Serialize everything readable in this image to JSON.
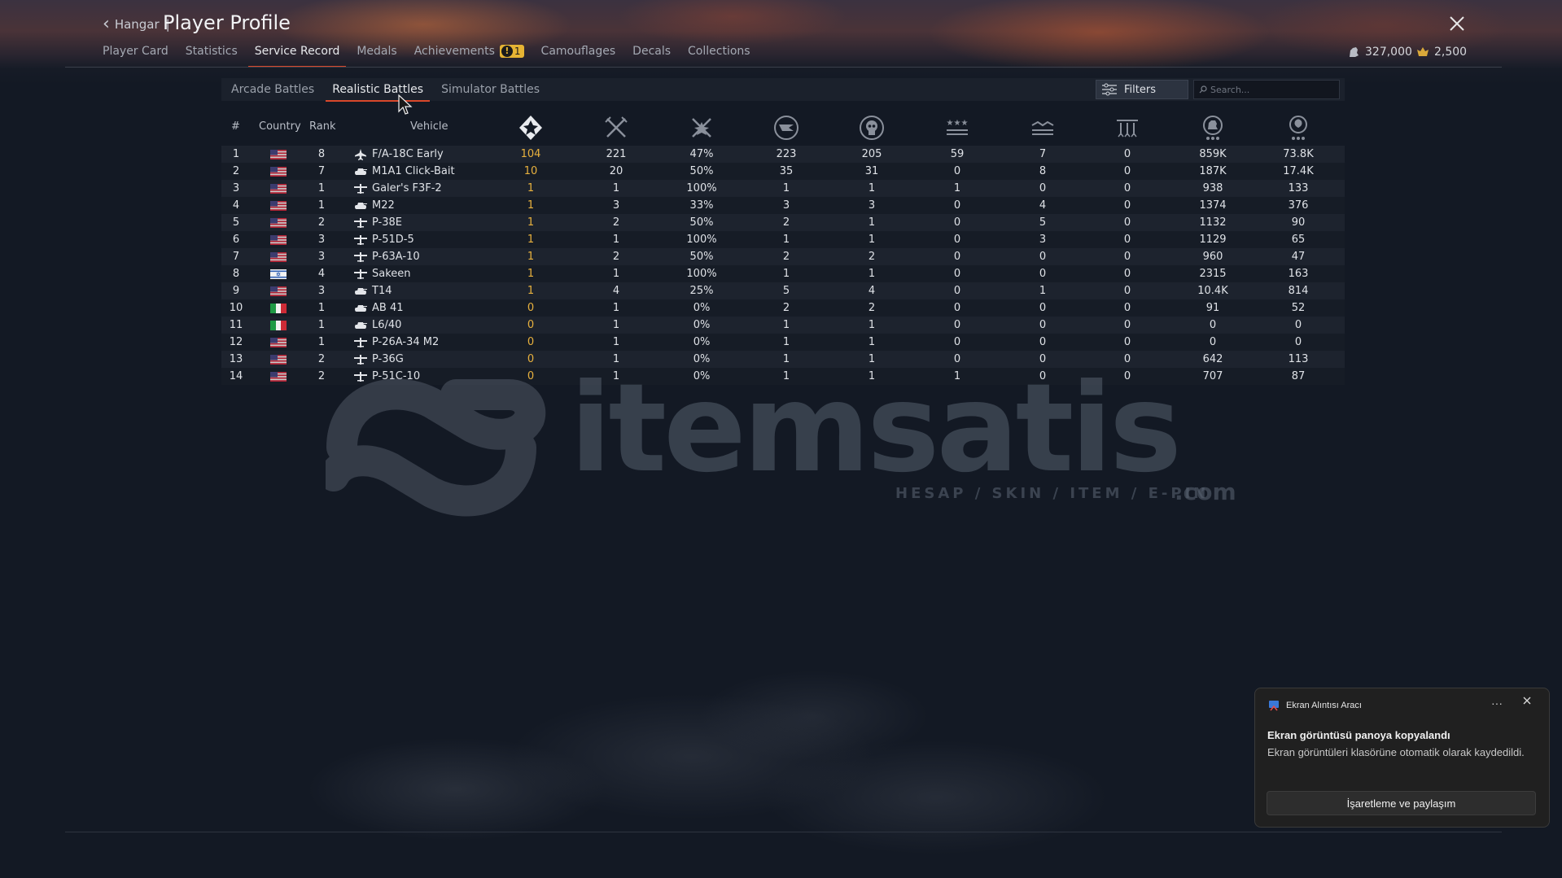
{
  "header": {
    "back_label": "Hangar",
    "separator": "|",
    "title": "Player Profile",
    "currencies": [
      {
        "icon": "silver-lions-icon",
        "value": "327,000"
      },
      {
        "icon": "golden-eagles-icon",
        "value": "2,500"
      }
    ]
  },
  "nav": {
    "tabs": [
      "Player Card",
      "Statistics",
      "Service Record",
      "Medals",
      "Achievements",
      "Camouflages",
      "Decals",
      "Collections"
    ],
    "active": "Service Record",
    "achievements_badge": "1"
  },
  "subtabs": {
    "items": [
      "Arcade Battles",
      "Realistic Battles",
      "Simulator Battles"
    ],
    "active": "Realistic Battles",
    "filters_label": "Filters",
    "search_placeholder": "Search..."
  },
  "table": {
    "headers": {
      "num": "#",
      "country": "Country",
      "rank": "Rank",
      "vehicle": "Vehicle"
    },
    "icon_columns": [
      "victories-icon",
      "battles-icon",
      "win-rate-icon",
      "respawns-icon",
      "deaths-icon",
      "air-kills-icon",
      "ground-kills-icon",
      "naval-kills-icon",
      "lions-earned-icon",
      "research-points-icon"
    ],
    "rows": [
      {
        "n": "1",
        "flag": "us",
        "rank": "8",
        "vtype": "jet",
        "vehicle": "F/A-18C Early",
        "v": [
          "104",
          "221",
          "47%",
          "223",
          "205",
          "59",
          "7",
          "0",
          "859K",
          "73.8K"
        ]
      },
      {
        "n": "2",
        "flag": "us",
        "rank": "7",
        "vtype": "tank",
        "vehicle": "M1A1 Click-Bait",
        "v": [
          "10",
          "20",
          "50%",
          "35",
          "31",
          "0",
          "8",
          "0",
          "187K",
          "17.4K"
        ]
      },
      {
        "n": "3",
        "flag": "us",
        "rank": "1",
        "vtype": "plane",
        "vehicle": "Galer's F3F-2",
        "v": [
          "1",
          "1",
          "100%",
          "1",
          "1",
          "1",
          "0",
          "0",
          "938",
          "133"
        ]
      },
      {
        "n": "4",
        "flag": "us",
        "rank": "1",
        "vtype": "tank",
        "vehicle": "M22",
        "v": [
          "1",
          "3",
          "33%",
          "3",
          "3",
          "0",
          "4",
          "0",
          "1374",
          "376"
        ]
      },
      {
        "n": "5",
        "flag": "us",
        "rank": "2",
        "vtype": "plane",
        "vehicle": "P-38E",
        "v": [
          "1",
          "2",
          "50%",
          "2",
          "1",
          "0",
          "5",
          "0",
          "1132",
          "90"
        ]
      },
      {
        "n": "6",
        "flag": "us",
        "rank": "3",
        "vtype": "plane",
        "vehicle": "P-51D-5",
        "v": [
          "1",
          "1",
          "100%",
          "1",
          "1",
          "0",
          "3",
          "0",
          "1129",
          "65"
        ]
      },
      {
        "n": "7",
        "flag": "us",
        "rank": "3",
        "vtype": "plane",
        "vehicle": "P-63A-10",
        "v": [
          "1",
          "2",
          "50%",
          "2",
          "2",
          "0",
          "0",
          "0",
          "960",
          "47"
        ]
      },
      {
        "n": "8",
        "flag": "il",
        "rank": "4",
        "vtype": "plane",
        "vehicle": "Sakeen",
        "v": [
          "1",
          "1",
          "100%",
          "1",
          "1",
          "0",
          "0",
          "0",
          "2315",
          "163"
        ]
      },
      {
        "n": "9",
        "flag": "us",
        "rank": "3",
        "vtype": "tank",
        "vehicle": "T14",
        "v": [
          "1",
          "4",
          "25%",
          "5",
          "4",
          "0",
          "1",
          "0",
          "10.4K",
          "814"
        ]
      },
      {
        "n": "10",
        "flag": "it",
        "rank": "1",
        "vtype": "tank",
        "vehicle": "AB 41",
        "v": [
          "0",
          "1",
          "0%",
          "2",
          "2",
          "0",
          "0",
          "0",
          "91",
          "52"
        ]
      },
      {
        "n": "11",
        "flag": "it",
        "rank": "1",
        "vtype": "tank",
        "vehicle": "L6/40",
        "v": [
          "0",
          "1",
          "0%",
          "1",
          "1",
          "0",
          "0",
          "0",
          "0",
          "0"
        ]
      },
      {
        "n": "12",
        "flag": "us",
        "rank": "1",
        "vtype": "plane",
        "vehicle": "P-26A-34 M2",
        "v": [
          "0",
          "1",
          "0%",
          "1",
          "1",
          "0",
          "0",
          "0",
          "0",
          "0"
        ]
      },
      {
        "n": "13",
        "flag": "us",
        "rank": "2",
        "vtype": "plane",
        "vehicle": "P-36G",
        "v": [
          "0",
          "1",
          "0%",
          "1",
          "1",
          "0",
          "0",
          "0",
          "642",
          "113"
        ]
      },
      {
        "n": "14",
        "flag": "us",
        "rank": "2",
        "vtype": "plane",
        "vehicle": "P-51C-10",
        "v": [
          "0",
          "1",
          "0%",
          "1",
          "1",
          "1",
          "0",
          "0",
          "707",
          "87"
        ]
      }
    ]
  },
  "watermark": {
    "brand": "itemsatis",
    "tagline": "HESAP / SKIN / ITEM / E-PIN",
    "tld": ".com"
  },
  "toast": {
    "app_name": "Ekran Alıntısı Aracı",
    "title": "Ekran görüntüsü panoya kopyalandı",
    "body": "Ekran görüntüleri klasörüne otomatik olarak kaydedildi.",
    "button": "İşaretleme ve paylaşım"
  },
  "colors": {
    "accent": "#d9482b",
    "gold": "#e8b13e",
    "badge": "#e6b433"
  }
}
